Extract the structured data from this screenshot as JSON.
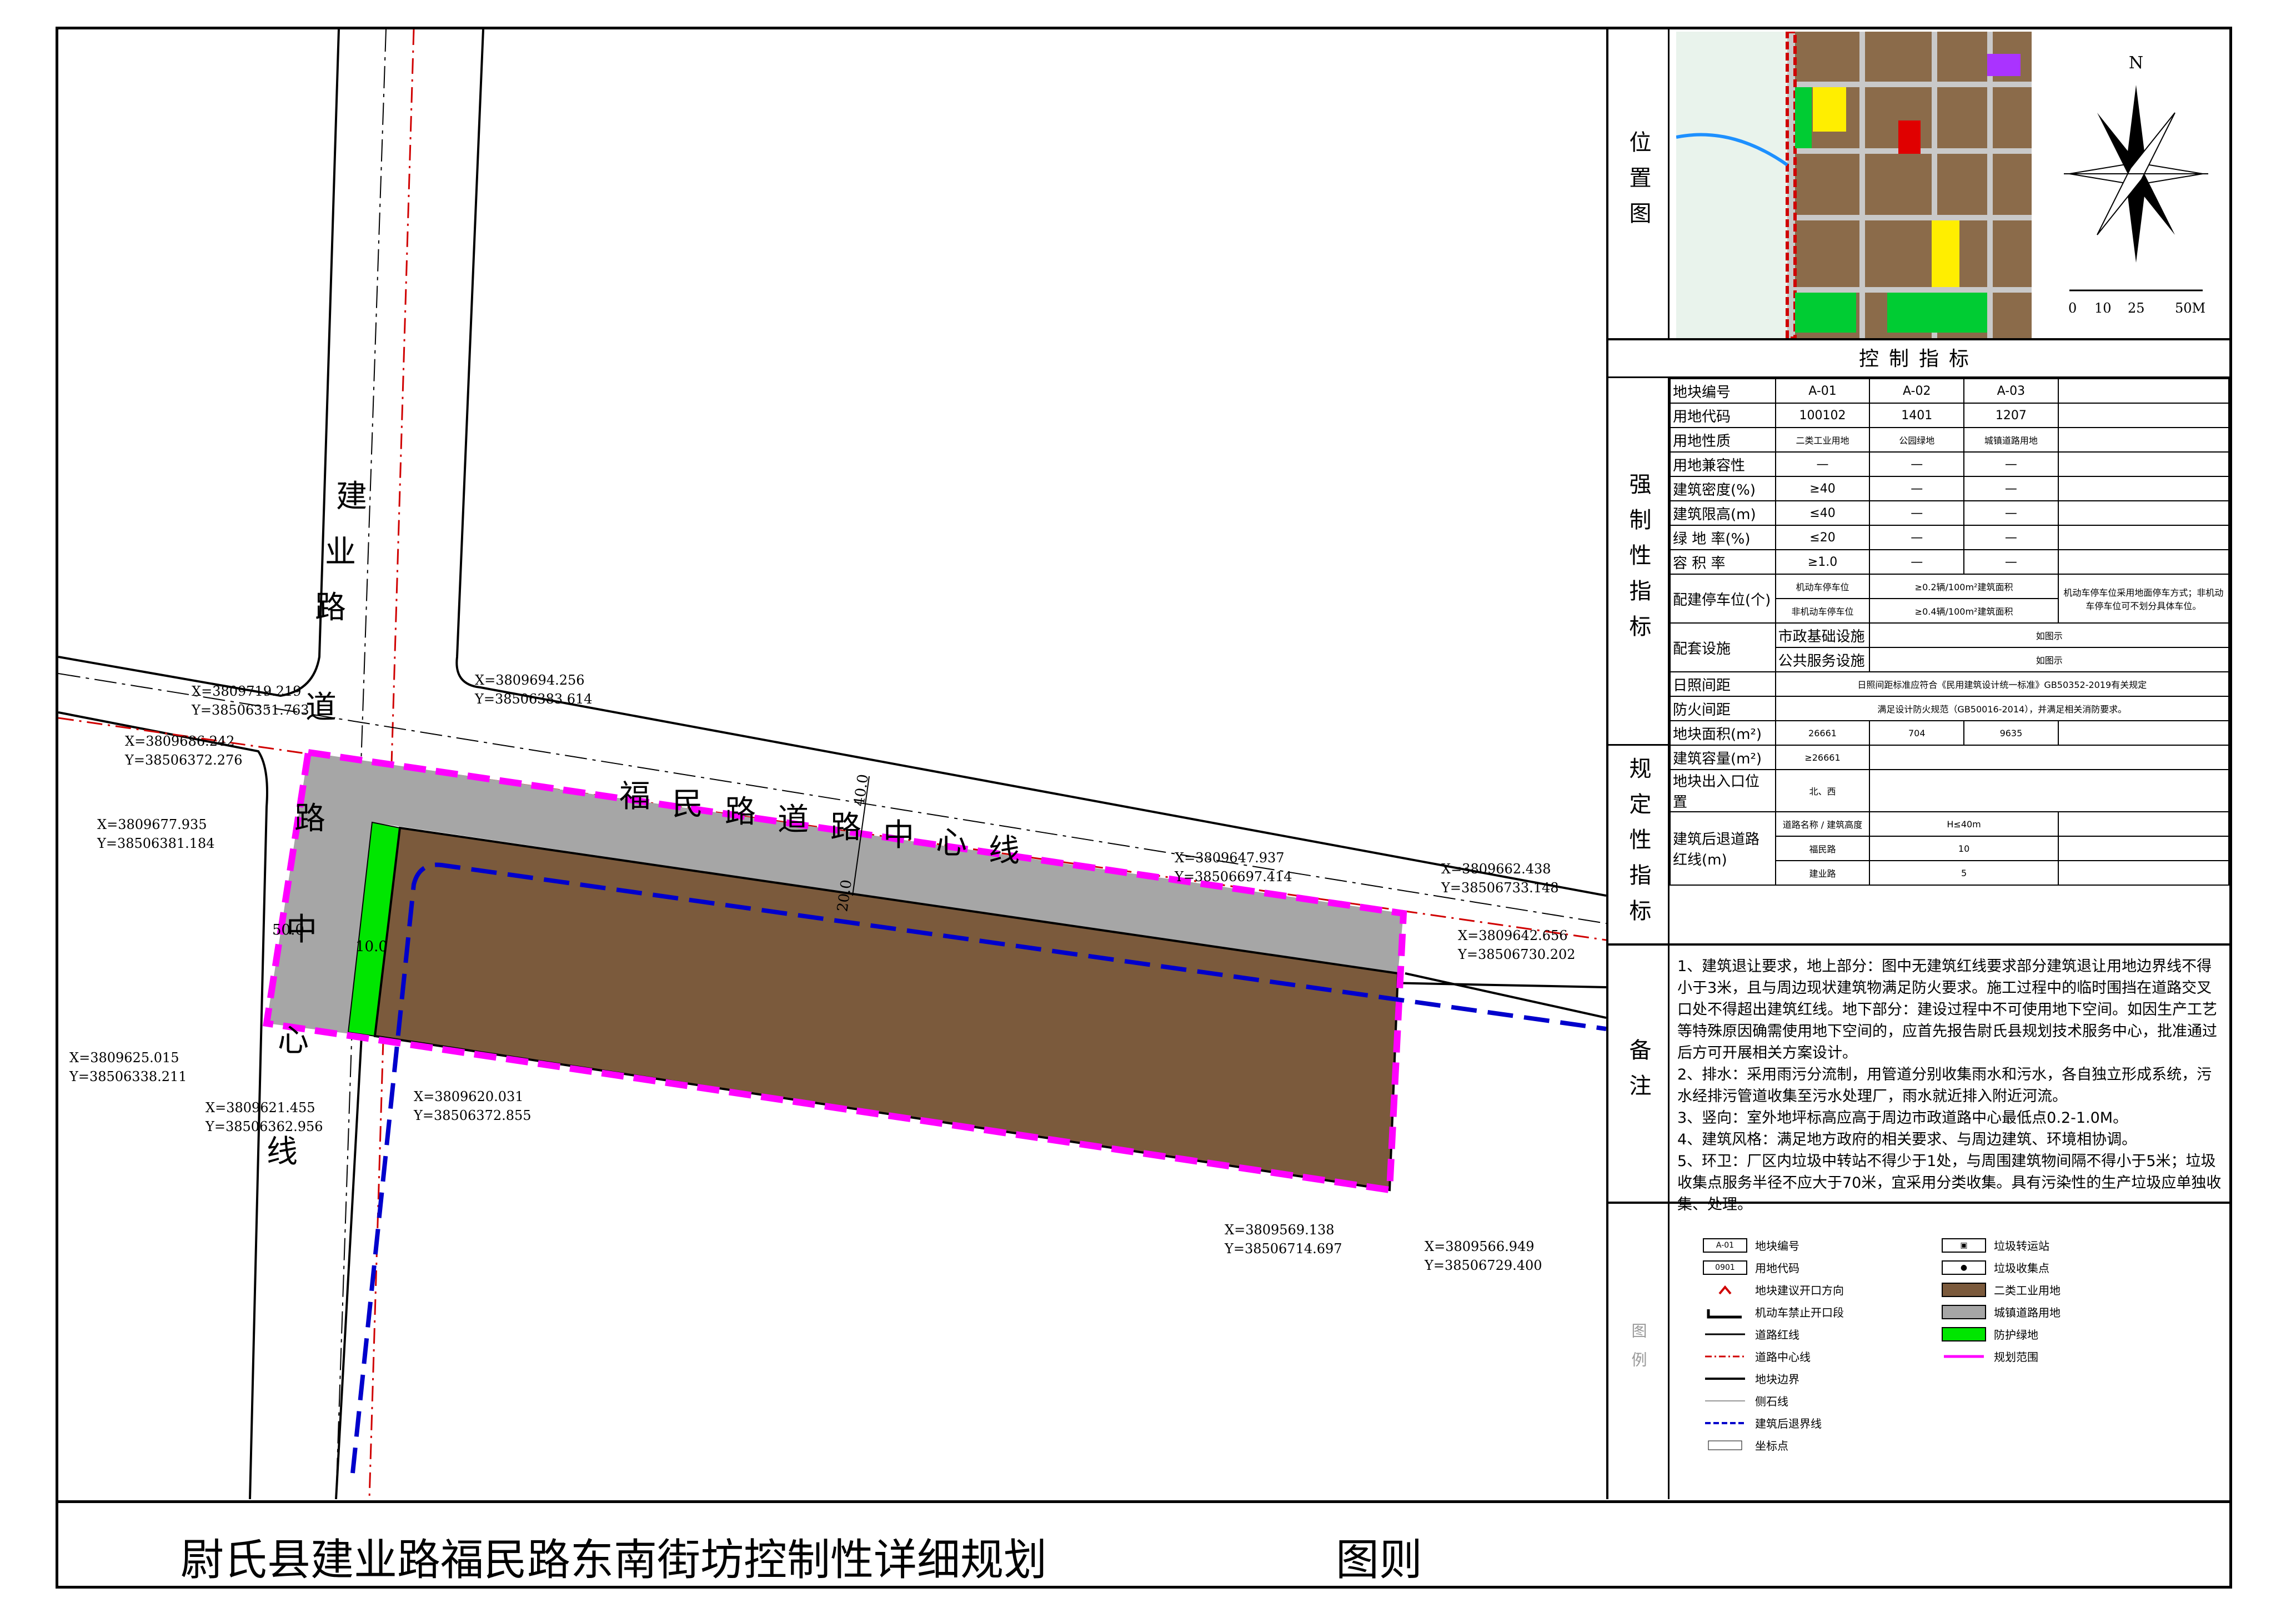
{
  "title": {
    "main": "尉氏县建业路福民路东南街坊控制性详细规划",
    "sub": "图则"
  },
  "map": {
    "road_vertical": "建业路道路中心线",
    "road_horizontal": "福民路道路中心线",
    "dims": [
      "50.0",
      "10.0",
      "40.0",
      "20.0"
    ],
    "coords": [
      {
        "x": "X=3809719.219",
        "y": "Y=38506351.763"
      },
      {
        "x": "X=3809694.256",
        "y": "Y=38506383.614"
      },
      {
        "x": "X=3809686.242",
        "y": "Y=38506372.276"
      },
      {
        "x": "X=3809677.935",
        "y": "Y=38506381.184"
      },
      {
        "x": "X=3809647.937",
        "y": "Y=38506697.414"
      },
      {
        "x": "X=3809662.438",
        "y": "Y=38506733.148"
      },
      {
        "x": "X=3809642.656",
        "y": "Y=38506730.202"
      },
      {
        "x": "X=3809625.015",
        "y": "Y=38506338.211"
      },
      {
        "x": "X=3809620.031",
        "y": "Y=38506372.855"
      },
      {
        "x": "X=3809621.455",
        "y": "Y=38506362.956"
      },
      {
        "x": "X=3809569.138",
        "y": "Y=38506714.697"
      },
      {
        "x": "X=3809566.949",
        "y": "Y=38506729.400"
      }
    ]
  },
  "location": {
    "label": "位置图",
    "scale": [
      "0",
      "10",
      "25",
      "50M"
    ],
    "north": "N"
  },
  "indicators": {
    "title": "控制指标",
    "mandatory_label": "强制性指标",
    "prescriptive_label": "规定性指标",
    "rows": [
      {
        "k": "地块编号",
        "v": [
          "A-01",
          "A-02",
          "A-03"
        ]
      },
      {
        "k": "用地代码",
        "v": [
          "100102",
          "1401",
          "1207"
        ]
      },
      {
        "k": "用地性质",
        "v": [
          "二类工业用地",
          "公园绿地",
          "城镇道路用地"
        ]
      },
      {
        "k": "用地兼容性",
        "v": [
          "—",
          "—",
          "—"
        ]
      },
      {
        "k": "建筑密度(%)",
        "v": [
          "≥40",
          "—",
          "—"
        ]
      },
      {
        "k": "建筑限高(m)",
        "v": [
          "≤40",
          "—",
          "—"
        ]
      },
      {
        "k": "绿 地 率(%)",
        "v": [
          "≤20",
          "—",
          "—"
        ]
      },
      {
        "k": "容 积 率",
        "v": [
          "≥1.0",
          "—",
          "—"
        ]
      }
    ],
    "parking": {
      "k": "配建停车位(个)",
      "r1": [
        "机动车停车位",
        "≥0.2辆/100m²建筑面积"
      ],
      "r2": [
        "非机动车停车位",
        "≥0.4辆/100m²建筑面积"
      ],
      "note": "机动车停车位采用地面停车方式；非机动车停车位可不划分具体车位。"
    },
    "facilities": {
      "k": "配套设施",
      "r1": [
        "市政基础设施",
        "如图示"
      ],
      "r2": [
        "公共服务设施",
        "如图示"
      ]
    },
    "sunlight": {
      "k": "日照间距",
      "v": "日照间距标准应符合《民用建筑设计统一标准》GB50352-2019有关规定"
    },
    "fire": {
      "k": "防火间距",
      "v": "满足设计防火规范（GB50016-2014），并满足相关消防要求。"
    },
    "area": {
      "k": "地块面积(m²)",
      "v": [
        "26661",
        "704",
        "9635"
      ]
    },
    "capacity": {
      "k": "建筑容量(m²)",
      "v": "≥26661"
    },
    "entrance": {
      "k": "地块出入口位置",
      "v": "北、西"
    },
    "setback": {
      "k": "建筑后退道路红线(m)",
      "header": [
        "道路名称",
        "建筑高度",
        "H≤40m"
      ],
      "rows": [
        [
          "福民路",
          "10"
        ],
        [
          "建业路",
          "5"
        ]
      ]
    }
  },
  "remarks": {
    "label": "备注",
    "items": [
      "1、建筑退让要求，地上部分：图中无建筑红线要求部分建筑退让用地边界线不得小于3米，且与周边现状建筑物满足防火要求。施工过程中的临时围挡在道路交叉口处不得超出建筑红线。地下部分：建设过程中不可使用地下空间。如因生产工艺等特殊原因确需使用地下空间的，应首先报告尉氏县规划技术服务中心，批准通过后方可开展相关方案设计。",
      "2、排水：采用雨污分流制，用管道分别收集雨水和污水，各自独立形成系统，污水经排污管道收集至污水处理厂，雨水就近排入附近河流。",
      "3、竖向：室外地坪标高应高于周边市政道路中心最低点0.2-1.0M。",
      "4、建筑风格：满足地方政府的相关要求、与周边建筑、环境相协调。",
      "5、环卫：厂区内垃圾中转站不得少于1处，与周围建筑物间隔不得小于5米；垃圾收集点服务半径不应大于70米，宜采用分类收集。具有污染性的生产垃圾应单独收集、处理。"
    ]
  },
  "legend": {
    "label": "图例",
    "left": [
      {
        "sym": "A-01",
        "t": "地块编号"
      },
      {
        "sym": "0901",
        "t": "用地代码"
      },
      {
        "sym": "",
        "t": "地块建议开口方向"
      },
      {
        "sym": "",
        "t": "机动车禁止开口段"
      },
      {
        "sym": "",
        "t": "道路红线"
      },
      {
        "sym": "",
        "t": "道路中心线"
      },
      {
        "sym": "",
        "t": "地块边界"
      },
      {
        "sym": "",
        "t": "侧石线"
      },
      {
        "sym": "",
        "t": "建筑后退界线"
      },
      {
        "sym": "",
        "t": "坐标点"
      }
    ],
    "right": [
      {
        "t": "垃圾转运站"
      },
      {
        "t": "垃圾收集点"
      },
      {
        "t": "二类工业用地"
      },
      {
        "t": "城镇道路用地"
      },
      {
        "t": "防护绿地"
      },
      {
        "t": "规划范围"
      }
    ],
    "colors": {
      "industrial": "#7b5a3c",
      "road": "#a6a6a6",
      "green": "#00e600",
      "boundary": "#ff00ff",
      "setback": "#0000cc",
      "redline": "#d00000"
    }
  }
}
